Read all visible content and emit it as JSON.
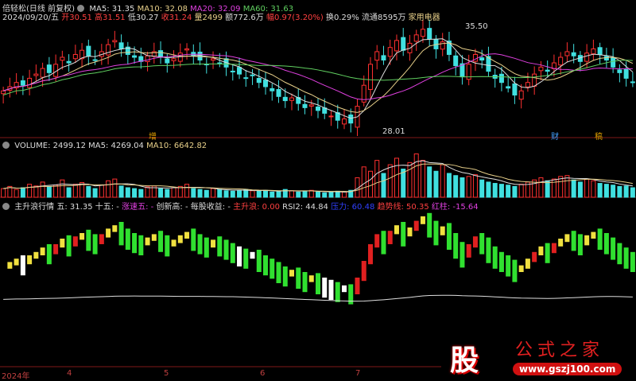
{
  "header": {
    "title": "倍轻松(日线 前复权)",
    "ma5": "MA5: 31.35",
    "ma10": "MA10: 32.08",
    "ma20": "MA20: 32.09",
    "ma60": "MA60: 31.63",
    "date": "2024/09/20/五",
    "open": "开30.51",
    "high": "高31.51",
    "low": "低30.27",
    "close": "收31.24",
    "vol": "量2499",
    "amount": "额772.6万",
    "change": "幅0.97(3.20%)",
    "turnover": "换0.29%",
    "float": "流通8595万",
    "sector": "家用电器"
  },
  "markers": {
    "high": "35.50",
    "low": "28.01",
    "m1": "增",
    "m2": "财",
    "m3": "稿"
  },
  "volume_header": {
    "vol": "VOLUME: 2499.12",
    "ma5": "MA5: 4269.04",
    "ma10": "MA10: 6642.82"
  },
  "indicator_header": {
    "name": "主升浪行情",
    "five": "五: 31.35",
    "fifteen": "十五: -",
    "speed": "涨速五: -",
    "newhigh": "创新高: -",
    "eps": "每股收益: -",
    "main": "主升浪: 0.00",
    "rsi": "RSI2: 44.84",
    "pressure": "压力: 60.48",
    "trend": "趋势线: 50.35",
    "redbar": "红柱: -15.64"
  },
  "axis": {
    "labels": [
      "2024年",
      "4",
      "5",
      "6",
      "7"
    ]
  },
  "logo": {
    "char": "股",
    "name": "公式之家",
    "url": "www.gszj100.com"
  },
  "chart_data": {
    "type": "candlestick",
    "ylim": [
      27.5,
      36
    ],
    "closes": [
      30.6,
      30.9,
      31.2,
      31.0,
      31.5,
      31.8,
      32.2,
      31.9,
      32.5,
      33.0,
      32.6,
      33.2,
      33.5,
      33.1,
      32.8,
      33.4,
      33.9,
      34.2,
      33.6,
      33.2,
      33.0,
      32.7,
      33.1,
      33.4,
      33.0,
      32.6,
      32.9,
      33.3,
      33.6,
      33.1,
      32.8,
      32.5,
      32.9,
      32.6,
      32.3,
      32.0,
      31.8,
      31.5,
      31.7,
      31.2,
      30.9,
      30.6,
      30.2,
      29.9,
      30.1,
      29.7,
      29.4,
      29.6,
      29.2,
      29.0,
      28.8,
      28.5,
      28.6,
      28.3,
      29.5,
      31.0,
      32.5,
      33.4,
      32.8,
      33.7,
      34.2,
      33.5,
      34.0,
      34.6,
      35.0,
      34.3,
      33.6,
      34.1,
      33.2,
      32.4,
      31.6,
      32.5,
      33.2,
      32.8,
      32.0,
      31.5,
      31.2,
      30.8,
      30.3,
      30.6,
      31.2,
      31.8,
      32.3,
      32.0,
      32.6,
      33.0,
      33.4,
      33.1,
      32.7,
      33.3,
      33.6,
      33.2,
      32.8,
      32.3,
      31.9,
      31.5,
      31.24
    ],
    "volumes": [
      20,
      25,
      18,
      22,
      30,
      26,
      35,
      24,
      28,
      40,
      22,
      30,
      34,
      25,
      20,
      28,
      38,
      42,
      26,
      22,
      20,
      18,
      24,
      26,
      20,
      18,
      22,
      25,
      30,
      20,
      18,
      16,
      20,
      18,
      15,
      14,
      16,
      18,
      15,
      14,
      16,
      12,
      14,
      18,
      15,
      12,
      14,
      16,
      12,
      10,
      12,
      14,
      12,
      16,
      45,
      70,
      60,
      85,
      55,
      75,
      90,
      65,
      80,
      100,
      85,
      70,
      60,
      75,
      55,
      50,
      45,
      48,
      52,
      40,
      35,
      32,
      30,
      28,
      25,
      30,
      35,
      40,
      45,
      38,
      42,
      48,
      50,
      40,
      35,
      42,
      38,
      32,
      30,
      28,
      25,
      26,
      22
    ]
  }
}
